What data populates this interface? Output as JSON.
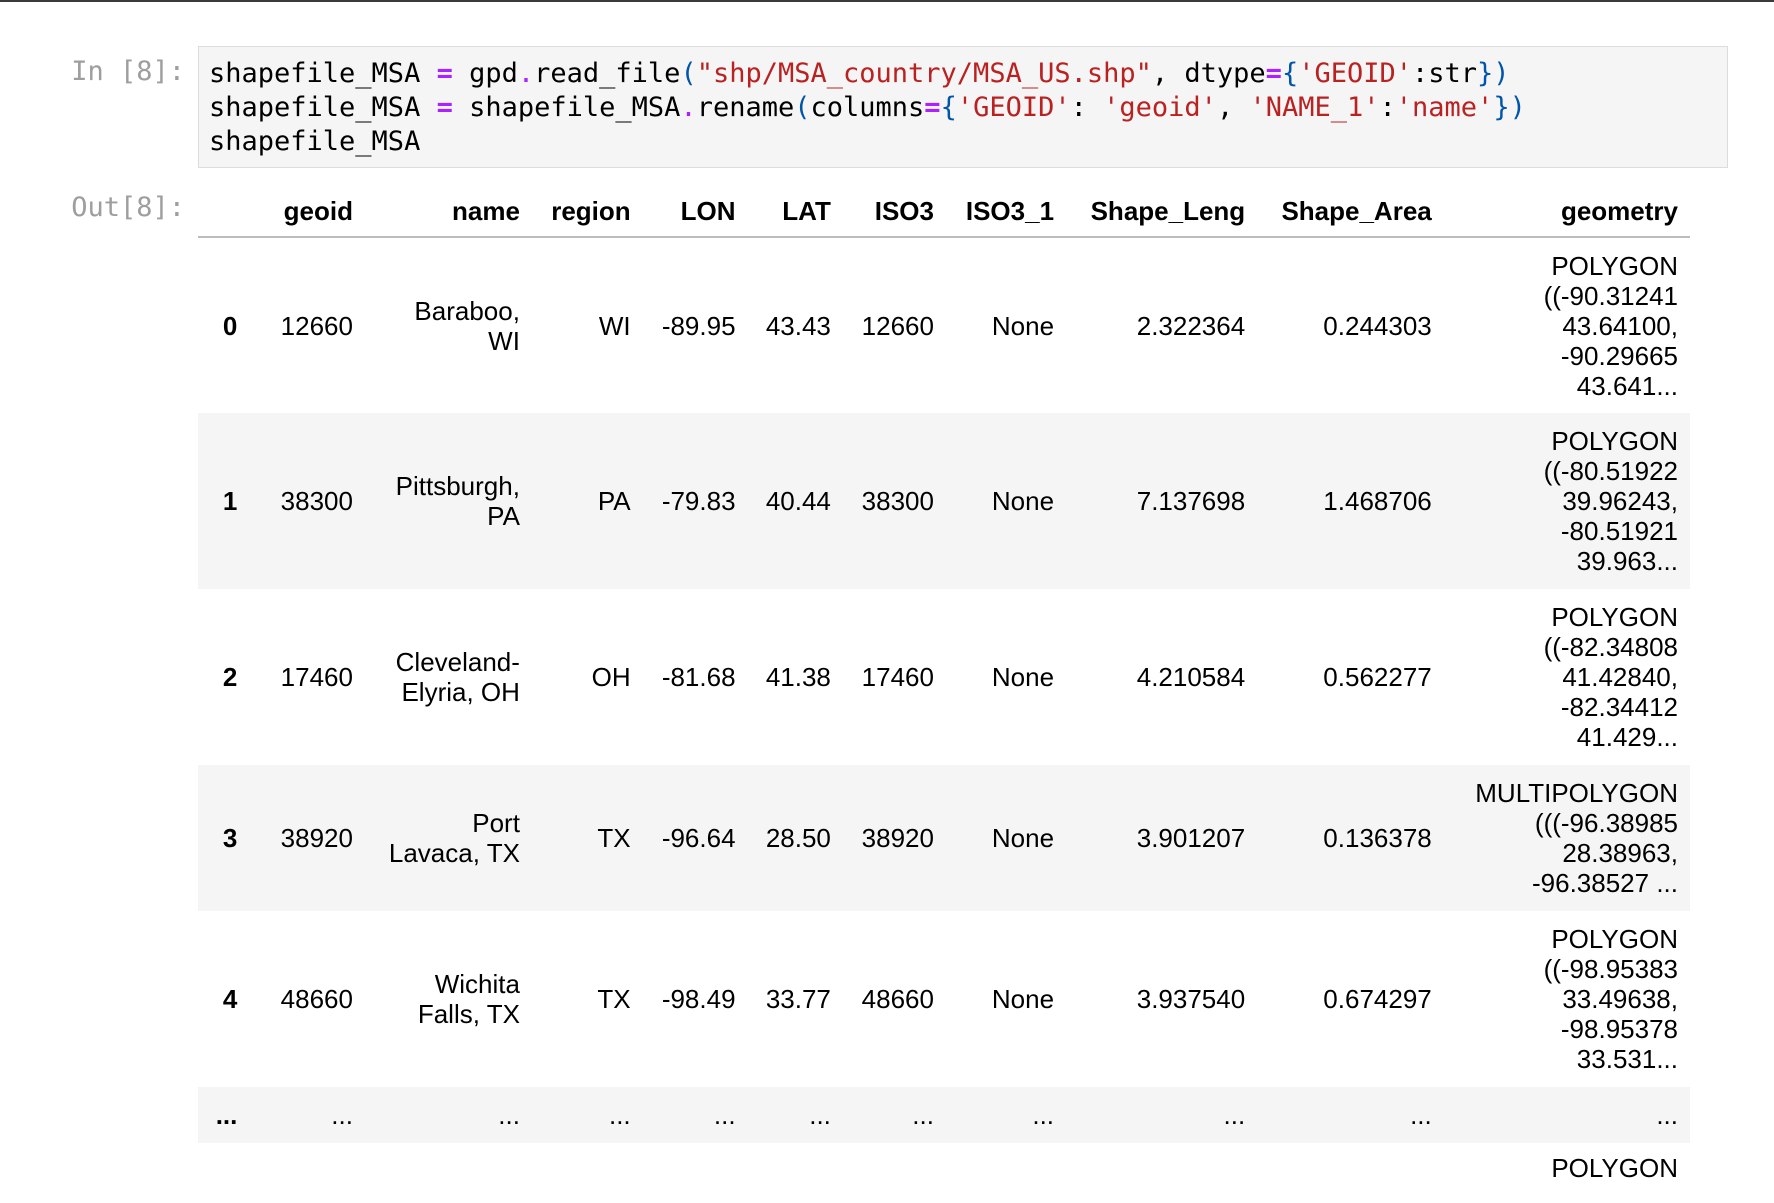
{
  "cell": {
    "in_prompt": "In [8]:",
    "out_prompt": "Out[8]:",
    "code": {
      "line1": {
        "a": "shapefile_MSA ",
        "b": "=",
        "c": " gpd",
        "d": ".",
        "e": "read_file",
        "f": "(",
        "g": "\"shp/MSA_country/MSA_US.shp\"",
        "h": ", dtype",
        "i": "=",
        "j": "{",
        "k": "'GEOID'",
        "l": ":str",
        "m": "})"
      },
      "line2": {
        "a": "shapefile_MSA ",
        "b": "=",
        "c": " shapefile_MSA",
        "d": ".",
        "e": "rename",
        "f": "(",
        "g": "columns",
        "h": "=",
        "i": "{",
        "j": "'GEOID'",
        "k": ": ",
        "l": "'geoid'",
        "m": ", ",
        "n": "'NAME_1'",
        "o": ":",
        "p": "'name'",
        "q": "})"
      },
      "line3": "shapefile_MSA"
    }
  },
  "table": {
    "columns": [
      "",
      "geoid",
      "name",
      "region",
      "LON",
      "LAT",
      "ISO3",
      "ISO3_1",
      "Shape_Leng",
      "Shape_Area",
      "geometry"
    ],
    "rows": [
      {
        "idx": "0",
        "geoid": "12660",
        "name1": "Baraboo,",
        "name2": "WI",
        "region": "WI",
        "lon": "-89.95",
        "lat": "43.43",
        "iso3": "12660",
        "iso3_1": "None",
        "leng": "2.322364",
        "area": "0.244303",
        "g1": "POLYGON",
        "g2": "((-90.31241",
        "g3": "43.64100,",
        "g4": "-90.29665",
        "g5": "43.641..."
      },
      {
        "idx": "1",
        "geoid": "38300",
        "name1": "Pittsburgh,",
        "name2": "PA",
        "region": "PA",
        "lon": "-79.83",
        "lat": "40.44",
        "iso3": "38300",
        "iso3_1": "None",
        "leng": "7.137698",
        "area": "1.468706",
        "g1": "POLYGON",
        "g2": "((-80.51922",
        "g3": "39.96243,",
        "g4": "-80.51921",
        "g5": "39.963..."
      },
      {
        "idx": "2",
        "geoid": "17460",
        "name1": "Cleveland-",
        "name2": "Elyria, OH",
        "region": "OH",
        "lon": "-81.68",
        "lat": "41.38",
        "iso3": "17460",
        "iso3_1": "None",
        "leng": "4.210584",
        "area": "0.562277",
        "g1": "POLYGON",
        "g2": "((-82.34808",
        "g3": "41.42840,",
        "g4": "-82.34412",
        "g5": "41.429..."
      },
      {
        "idx": "3",
        "geoid": "38920",
        "name1": "Port",
        "name2": "Lavaca, TX",
        "region": "TX",
        "lon": "-96.64",
        "lat": "28.50",
        "iso3": "38920",
        "iso3_1": "None",
        "leng": "3.901207",
        "area": "0.136378",
        "g1": "MULTIPOLYGON",
        "g2": "(((-96.38985",
        "g3": "28.38963,",
        "g4": "-96.38527 ...",
        "g5": ""
      },
      {
        "idx": "4",
        "geoid": "48660",
        "name1": "Wichita",
        "name2": "Falls, TX",
        "region": "TX",
        "lon": "-98.49",
        "lat": "33.77",
        "iso3": "48660",
        "iso3_1": "None",
        "leng": "3.937540",
        "area": "0.674297",
        "g1": "POLYGON",
        "g2": "((-98.95383",
        "g3": "33.49638,",
        "g4": "-98.95378",
        "g5": "33.531..."
      }
    ],
    "ellipsis": "...",
    "partial_geometry": "POLYGON"
  }
}
